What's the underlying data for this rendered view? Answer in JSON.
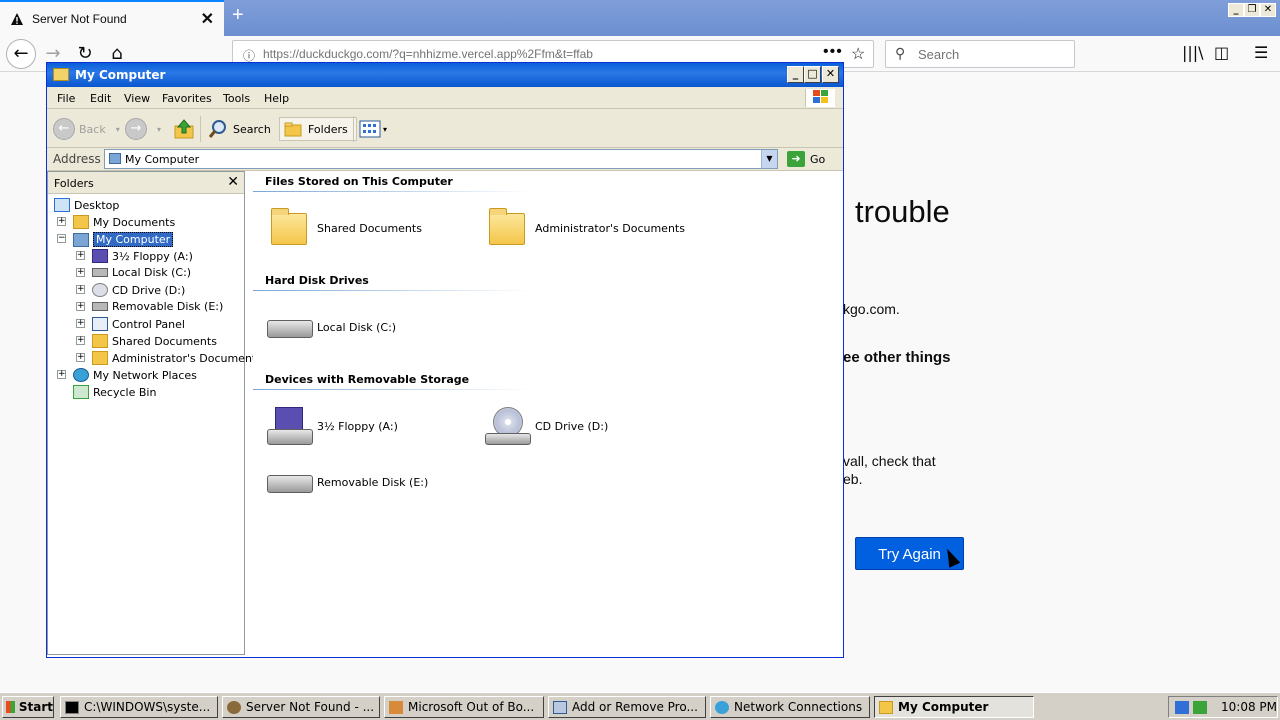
{
  "firefox": {
    "tab_title": "Server Not Found",
    "tab_close": "✕",
    "new_tab": "+",
    "url": "https://duckduckgo.com/?q=nhhizme.vercel.app%2Ffm&t=ffab",
    "search_placeholder": "Search",
    "page": {
      "heading_fragment": "trouble",
      "text1": "kgo.com.",
      "text2": "ee other things",
      "text3_line1": "vall, check that",
      "text3_line2": "eb.",
      "try_again": "Try Again"
    }
  },
  "window": {
    "title": "My Computer",
    "menu": [
      "File",
      "Edit",
      "View",
      "Favorites",
      "Tools",
      "Help"
    ],
    "toolbar": {
      "back": "Back",
      "search": "Search",
      "folders": "Folders"
    },
    "address_label": "Address",
    "address_value": "My Computer",
    "go_label": "Go",
    "folders_pane": {
      "header": "Folders",
      "close": "✕",
      "tree": [
        {
          "label": "Desktop"
        },
        {
          "label": "My Documents"
        },
        {
          "label": "My Computer"
        },
        {
          "label": "3½ Floppy (A:)"
        },
        {
          "label": "Local Disk (C:)"
        },
        {
          "label": "CD Drive (D:)"
        },
        {
          "label": "Removable Disk (E:)"
        },
        {
          "label": "Control Panel"
        },
        {
          "label": "Shared Documents"
        },
        {
          "label": "Administrator's Documents"
        },
        {
          "label": "My Network Places"
        },
        {
          "label": "Recycle Bin"
        }
      ]
    },
    "groups": [
      {
        "title": "Files Stored on This Computer",
        "items": [
          "Shared Documents",
          "Administrator's Documents"
        ]
      },
      {
        "title": "Hard Disk Drives",
        "items": [
          "Local Disk (C:)"
        ]
      },
      {
        "title": "Devices with Removable Storage",
        "items": [
          "3½ Floppy (A:)",
          "CD Drive (D:)",
          "Removable Disk (E:)"
        ]
      }
    ]
  },
  "taskbar": {
    "start": "Start",
    "tasks": [
      {
        "label": "C:\\WINDOWS\\syste..."
      },
      {
        "label": "Server Not Found - ..."
      },
      {
        "label": "Microsoft Out of Bo..."
      },
      {
        "label": "Add or Remove Pro..."
      },
      {
        "label": "Network Connections"
      },
      {
        "label": "My Computer"
      }
    ],
    "clock": "10:08 PM"
  },
  "colors": {
    "xp_title": "#0a5fd8",
    "firefox_accent": "#0060df",
    "selection": "#316ac5"
  }
}
